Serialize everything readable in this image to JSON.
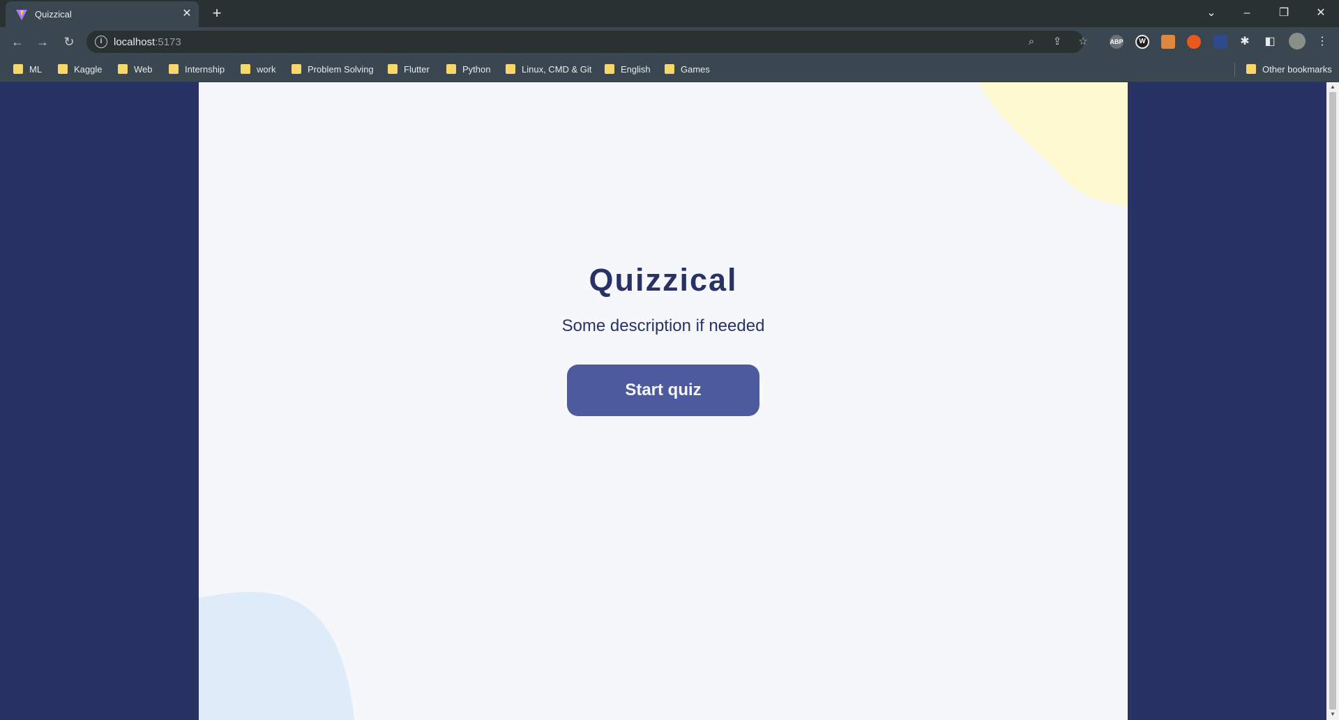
{
  "browser": {
    "tab": {
      "title": "Quizzical"
    },
    "address": {
      "host": "localhost",
      "port": ":5173"
    },
    "bookmarks": [
      "ML",
      "Kaggle",
      "Web",
      "Internship",
      "work",
      "Problem Solving",
      "Flutter",
      "Python",
      "Linux, CMD & Git",
      "English",
      "Games"
    ],
    "other_bookmarks": "Other bookmarks",
    "extensions": {
      "abp": "ABP",
      "w": "W"
    }
  },
  "page": {
    "title": "Quizzical",
    "description": "Some description if needed",
    "start_button": "Start quiz",
    "colors": {
      "background": "#F5F7FB",
      "primary": "#293264",
      "button": "#4D5B9E",
      "blob_yellow": "#FFFAD1",
      "blob_blue": "#DEEBF8"
    }
  }
}
